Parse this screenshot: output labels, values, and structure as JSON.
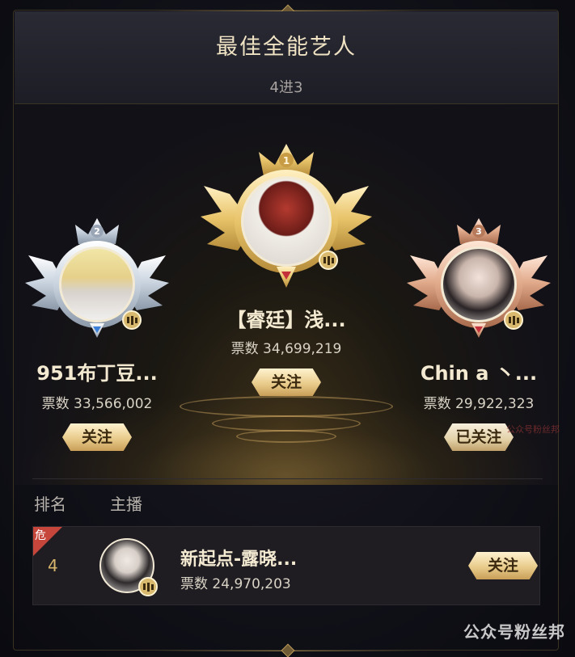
{
  "header": {
    "title": "最佳全能艺人",
    "subtitle": "4进3"
  },
  "podium": [
    {
      "rank": "1",
      "name": "【睿廷】浅...",
      "votes": "票数 34,699,219",
      "button": "关注",
      "medal": "gold"
    },
    {
      "rank": "2",
      "name": "951布丁豆...",
      "votes": "票数 33,566,002",
      "button": "关注",
      "medal": "silver"
    },
    {
      "rank": "3",
      "name": "Chin a 丶...",
      "votes": "票数 29,922,323",
      "button": "已关注",
      "medal": "bronze"
    }
  ],
  "list": {
    "col_rank": "排名",
    "col_host": "主播",
    "rows": [
      {
        "danger": "危",
        "rank": "4",
        "name": "新起点-露晓...",
        "votes": "票数 24,970,203",
        "button": "关注"
      }
    ]
  },
  "watermark": "公众号粉丝邦",
  "watermark_faint": "公众号粉丝邦",
  "colors": {
    "gold": "#e8c46a",
    "silver": "#c9d3df",
    "bronze": "#e0a98a",
    "accent_text": "#f4ead2",
    "danger": "#c6463b"
  }
}
